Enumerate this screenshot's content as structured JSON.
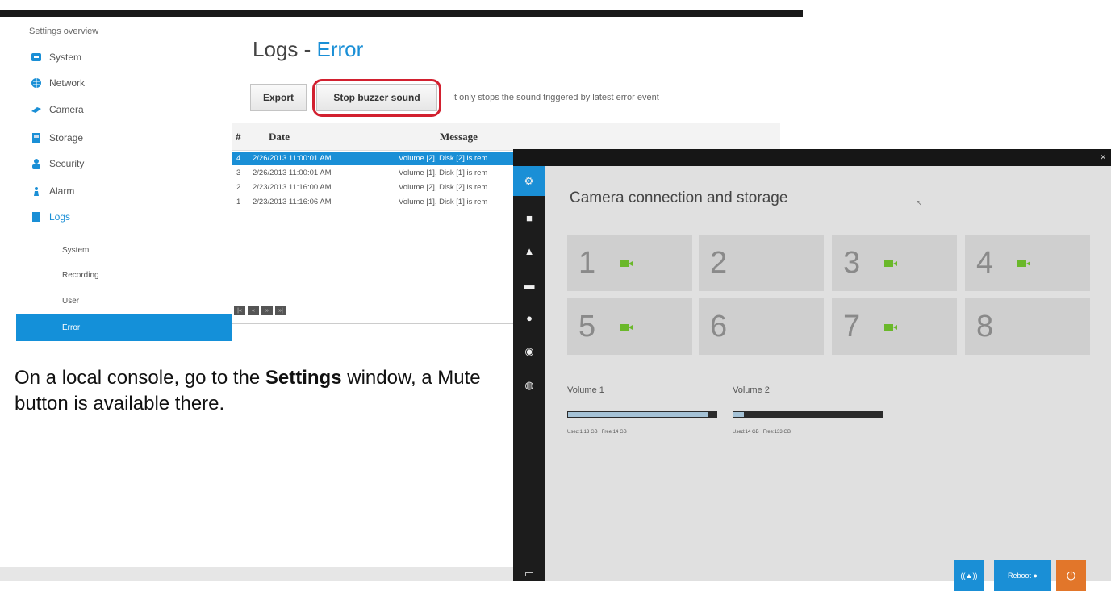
{
  "web_ui": {
    "settings_overview": "Settings overview",
    "nav": [
      {
        "label": "System",
        "icon": "system-icon",
        "color": "#1a8fd6"
      },
      {
        "label": "Network",
        "icon": "network-icon",
        "color": "#1a8fd6"
      },
      {
        "label": "Camera",
        "icon": "camera-icon",
        "color": "#1a8fd6"
      },
      {
        "label": "Storage",
        "icon": "storage-icon",
        "color": "#1a8fd6"
      },
      {
        "label": "Security",
        "icon": "security-icon",
        "color": "#1a8fd6"
      },
      {
        "label": "Alarm",
        "icon": "alarm-icon",
        "color": "#1a8fd6"
      },
      {
        "label": "Logs",
        "icon": "logs-icon",
        "color": "#1a8fd6"
      }
    ],
    "log_subitems": [
      "System",
      "Recording",
      "User"
    ],
    "active_subitem": "Error",
    "title_prefix": "Logs - ",
    "title_highlight": "Error",
    "export_button": "Export",
    "stop_buzzer_button": "Stop buzzer sound",
    "hint": "It only stops the sound triggered by latest error event",
    "table": {
      "headers": [
        "#",
        "Date",
        "Message"
      ],
      "rows": [
        {
          "num": "4",
          "date": "2/26/2013 11:00:01 AM",
          "message": "Volume [2], Disk [2] is rem",
          "selected": true
        },
        {
          "num": "3",
          "date": "2/26/2013 11:00:01 AM",
          "message": "Volume [1], Disk [1] is rem",
          "selected": false
        },
        {
          "num": "2",
          "date": "2/23/2013 11:16:00 AM",
          "message": "Volume [2], Disk [2] is rem",
          "selected": false
        },
        {
          "num": "1",
          "date": "2/23/2013 11:16:06 AM",
          "message": "Volume [1], Disk [1] is rem",
          "selected": false
        }
      ]
    },
    "pager": [
      "|«",
      "«",
      "»",
      "»|"
    ]
  },
  "caption": {
    "prefix": "On a local console, go to the ",
    "bold": "Settings",
    "suffix": " window, a Mute button is available there."
  },
  "console": {
    "close": "×",
    "title": "Camera connection and storage",
    "cameras": [
      {
        "num": "1",
        "connected": true
      },
      {
        "num": "2",
        "connected": false
      },
      {
        "num": "3",
        "connected": true
      },
      {
        "num": "4",
        "connected": true
      },
      {
        "num": "5",
        "connected": true
      },
      {
        "num": "6",
        "connected": false
      },
      {
        "num": "7",
        "connected": true
      },
      {
        "num": "8",
        "connected": false
      }
    ],
    "volumes": [
      {
        "name": "Volume 1",
        "used_fraction": 0.93,
        "used_label": "Used:1.13 GB",
        "free_label": "Free:14 GB"
      },
      {
        "name": "Volume 2",
        "used_fraction": 0.07,
        "used_label": "Used:14 GB",
        "free_label": "Free:133 GB"
      }
    ],
    "buttons": {
      "mute_label": "((▲))",
      "reboot_label": "Reboot",
      "power_label": "⏻"
    },
    "colors": {
      "accent": "#1a8fd6",
      "camera_green": "#6ab82a",
      "power": "#e2762a"
    }
  }
}
